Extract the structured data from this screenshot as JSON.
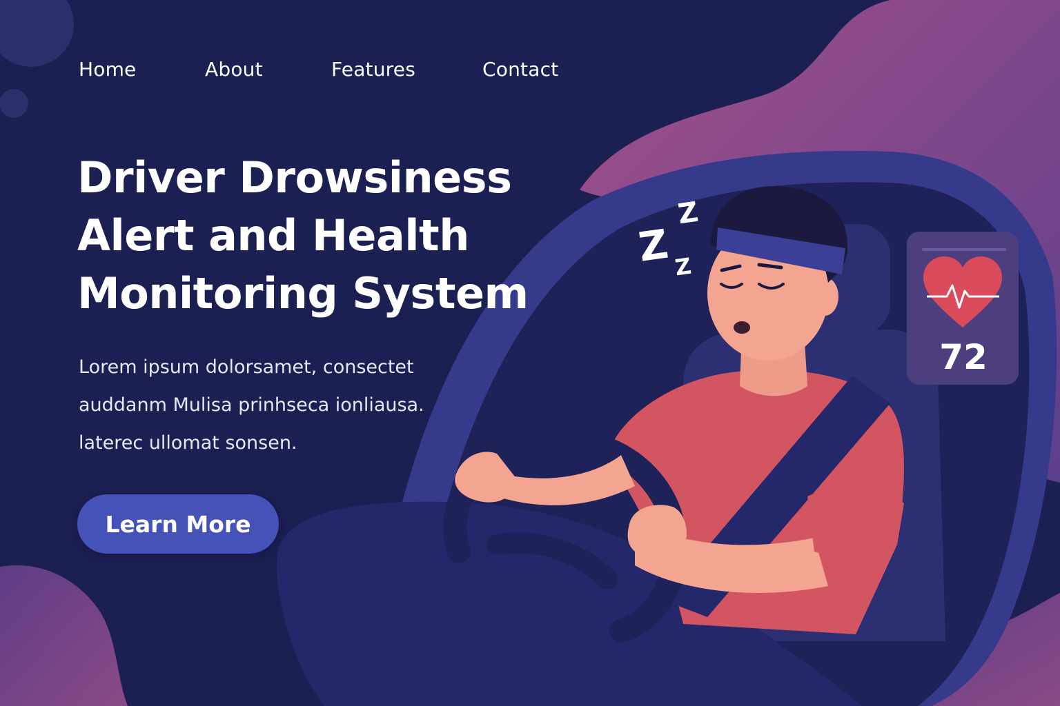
{
  "nav": {
    "items": [
      {
        "label": "Home"
      },
      {
        "label": "About"
      },
      {
        "label": "Features"
      },
      {
        "label": "Contact"
      }
    ]
  },
  "hero": {
    "title_lines": [
      "Driver Drowsiness",
      "Alert and Health",
      "Monitoring System"
    ],
    "body_lines": [
      "Lorem ipsum  dolorsamet, consectet",
      "auddanm Mulisa prinhseca ionliausa.",
      "laterec ullomat sonsen."
    ],
    "cta_label": "Learn More"
  },
  "illustration": {
    "sleep_symbol_text": [
      "Z",
      "Z",
      "Z"
    ],
    "heart_rate": {
      "icon": "heart-pulse-icon",
      "value": "72"
    }
  },
  "colors": {
    "background": "#1c1f52",
    "accent_button": "#4552b8",
    "blob_pink": "#a4508a",
    "heart_red": "#d94a5a",
    "shirt": "#d35562"
  }
}
